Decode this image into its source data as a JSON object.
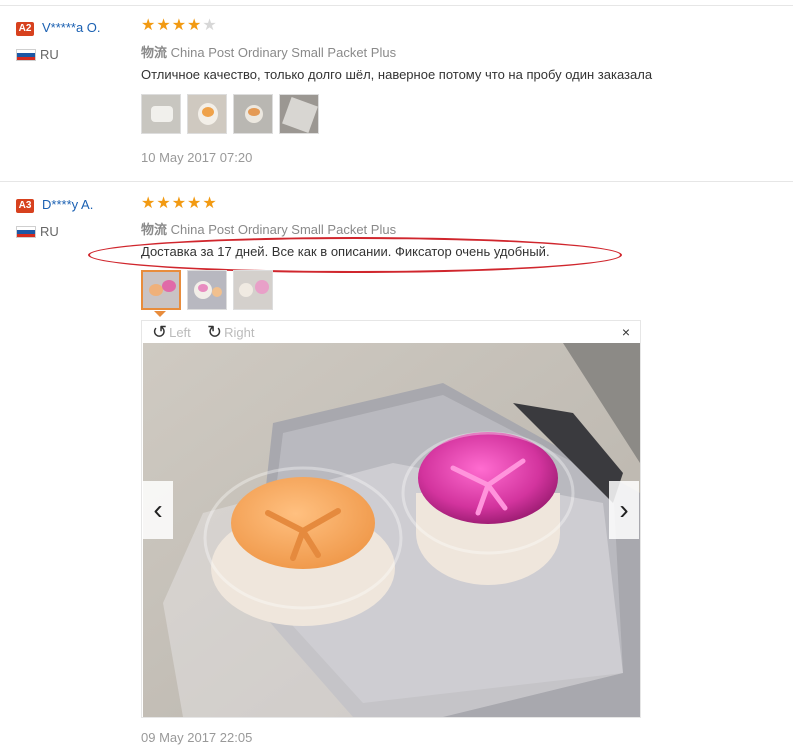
{
  "reviews": [
    {
      "badge": "A2",
      "user": "V*****a O.",
      "country": "RU",
      "stars": 4,
      "logistics_label": "物流",
      "logistics": "China Post Ordinary Small Packet Plus",
      "text": "Отличное качество, только долго шёл, наверное потому что на пробу один заказала",
      "date": "10 May 2017 07:20"
    },
    {
      "badge": "A3",
      "user": "D****y A.",
      "country": "RU",
      "stars": 5,
      "logistics_label": "物流",
      "logistics": "China Post Ordinary Small Packet Plus",
      "text": "Доставка за 17 дней. Все как в описании. Фиксатор очень удобный.",
      "date": "09 May 2017 22:05"
    }
  ],
  "viewer": {
    "rotate_left": "Left",
    "rotate_right": "Right",
    "close": "×",
    "prev": "‹",
    "next": "›"
  },
  "colors": {
    "accent": "#e88c3c",
    "star": "#f29a12",
    "link": "#1a60b2",
    "badge": "#d7411e",
    "highlight": "#d0262d"
  }
}
